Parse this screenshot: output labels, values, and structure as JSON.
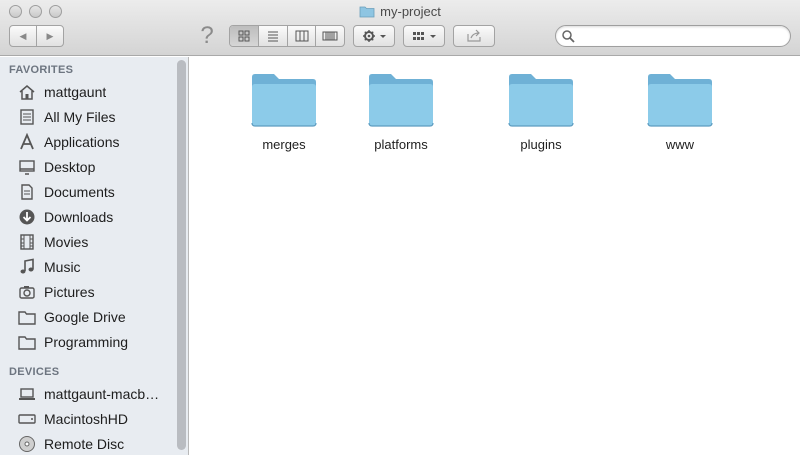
{
  "window": {
    "title": "my-project"
  },
  "toolbar": {
    "help_symbol": "?",
    "back_symbol": "◀",
    "forward_symbol": "▶"
  },
  "search": {
    "value": "",
    "placeholder": ""
  },
  "sidebar": {
    "favorites_header": "FAVORITES",
    "favorites": [
      {
        "label": "mattgaunt",
        "icon": "home-icon"
      },
      {
        "label": "All My Files",
        "icon": "all-files-icon"
      },
      {
        "label": "Applications",
        "icon": "applications-icon"
      },
      {
        "label": "Desktop",
        "icon": "desktop-icon"
      },
      {
        "label": "Documents",
        "icon": "documents-icon"
      },
      {
        "label": "Downloads",
        "icon": "downloads-icon"
      },
      {
        "label": "Movies",
        "icon": "movies-icon"
      },
      {
        "label": "Music",
        "icon": "music-icon"
      },
      {
        "label": "Pictures",
        "icon": "pictures-icon"
      },
      {
        "label": "Google Drive",
        "icon": "folder-icon"
      },
      {
        "label": "Programming",
        "icon": "folder-icon"
      }
    ],
    "devices_header": "DEVICES",
    "devices": [
      {
        "label": "mattgaunt-macb…",
        "icon": "laptop-icon"
      },
      {
        "label": "MacintoshHD",
        "icon": "hard-drive-icon"
      },
      {
        "label": "Remote Disc",
        "icon": "disc-icon"
      }
    ]
  },
  "content": {
    "folders": [
      {
        "name": "merges"
      },
      {
        "name": "platforms"
      },
      {
        "name": "plugins"
      },
      {
        "name": "www"
      }
    ]
  },
  "colors": {
    "folder_blue": "#7fbfe0",
    "sidebar_bg": "#e8ecf1"
  }
}
